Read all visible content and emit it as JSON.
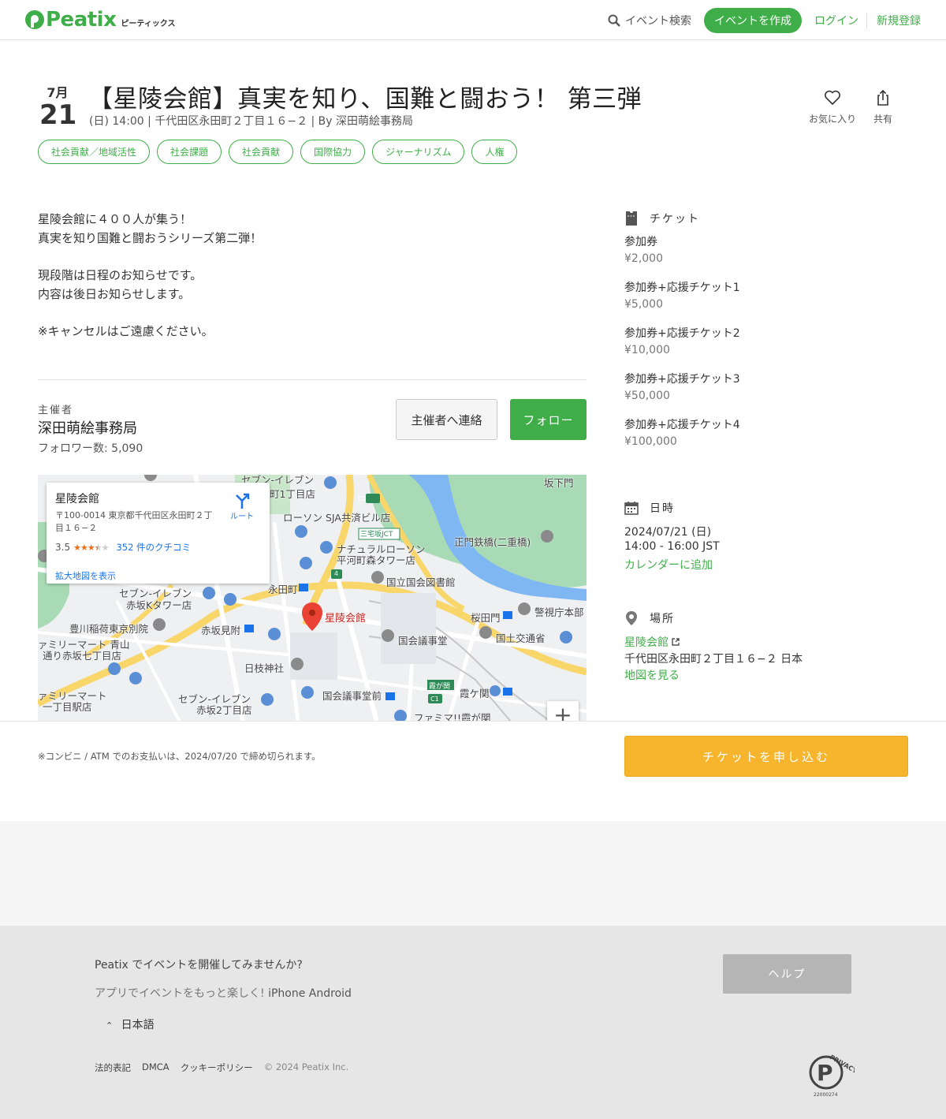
{
  "header": {
    "logo_text": "Peatix",
    "logo_sub": "ピーティックス",
    "search_label": "イベント検索",
    "create_label": "イベントを作成",
    "login_label": "ログイン",
    "signup_label": "新規登録",
    "brand_color": "#3fae49"
  },
  "event": {
    "month": "7月",
    "day": "21",
    "title": "【星陵会館】真実を知り、国難と闘おう！ 第三弾",
    "meta": "(日) 14:00 | 千代田区永田町２丁目１６−２ | By 深田萌絵事務局",
    "favorite_label": "お気に入り",
    "share_label": "共有",
    "tags": [
      "社会貢献／地域活性",
      "社会課題",
      "社会貢献",
      "国際協力",
      "ジャーナリズム",
      "人権"
    ]
  },
  "description": {
    "lines": [
      "星陵会館に４００人が集う！",
      "真実を知り国難と闘おうシリーズ第二弾！",
      "現段階は日程のお知らせです。",
      "内容は後日お知らせします。",
      "※キャンセルはご遠慮ください。"
    ]
  },
  "organizer": {
    "label": "主催者",
    "name": "深田萌絵事務局",
    "followers": "フォロワー数: 5,090",
    "contact_label": "主催者へ連絡",
    "follow_label": "フォロー"
  },
  "map": {
    "card_name": "星陵会館",
    "card_address": "〒100-0014 東京都千代田区永田町２丁目１６−２",
    "rating": "3.5",
    "stars_filled": 3.5,
    "reviews": "352 件のクチコミ",
    "enlarge": "拡大地図を表示",
    "route": "ルート",
    "zoom_in": "+",
    "labels": {
      "seven_eleven_top": "セブン-イレブン",
      "machi1": "町1丁目店",
      "lawson": "ローソン SJA共済ビル店",
      "sakashita": "坂下門",
      "miyake_jct": "三宅坂JCT",
      "natural_lawson": "ナチュラルローソン",
      "hirakawa": "平河町森タワー店",
      "seimon": "正門鉄橋(二重橋)",
      "nagatacho": "永田町",
      "kokkai_toshokan": "国立国会図書館",
      "seven_akasaka": "セブン-イレブン",
      "akasaka_k": "赤坂Kタワー店",
      "sakuradamon": "桜田門",
      "keishicho": "警視庁本部",
      "seiryo": "星陵会館",
      "toyokawa": "豊川稲荷東京別院",
      "akasaka_mitsuke": "赤坂見附",
      "kokkai_gijido": "国会議事堂",
      "kokudo": "国土交通省",
      "family_aoyama": "ァミリーマート 青山",
      "akasaka7": "通り赤坂七丁目店",
      "hie": "日枝神社",
      "kasumigaseki_tag": "霞が関",
      "kasumigaseki": "霞ケ関",
      "family_itchome": "ァミリーマート",
      "itchome_eki": "一丁目駅店",
      "seven_akasaka2": "セブン-イレブン",
      "akasaka2": "赤坂2丁目店",
      "gijido_mae": "国会議事堂前",
      "famima": "ファミマ!!霞が関",
      "c1": "C1",
      "r4": "4"
    }
  },
  "sidebar": {
    "ticket_heading": "チケット",
    "tickets": [
      {
        "name": "参加券",
        "price": "¥2,000"
      },
      {
        "name": "参加券+応援チケット1",
        "price": "¥5,000"
      },
      {
        "name": "参加券+応援チケット2",
        "price": "¥10,000"
      },
      {
        "name": "参加券+応援チケット3",
        "price": "¥50,000"
      },
      {
        "name": "参加券+応援チケット4",
        "price": "¥100,000"
      }
    ],
    "datetime_heading": "日時",
    "date": "2024/07/21 (日)",
    "time": "14:00 - 16:00 JST",
    "calendar_link": "カレンダーに追加",
    "place_heading": "場所",
    "venue_link": "星陵会館",
    "venue_address": "千代田区永田町２丁目１６−２ 日本",
    "map_link": "地図を見る"
  },
  "purchase": {
    "note": "※コンビニ / ATM でのお支払いは、2024/07/20 で締め切られます。",
    "apply_label": "チケットを申し込む",
    "apply_color": "#f6b52d"
  },
  "footer": {
    "host_prompt": "Peatix でイベントを開催してみませんか?",
    "app_prompt": "アプリでイベントをもっと楽しく!",
    "iphone": "iPhone",
    "android": "Android",
    "language": "日本語",
    "help_label": "ヘルプ",
    "links": [
      "法的表記",
      "DMCA",
      "クッキーポリシー"
    ],
    "copyright": "© 2024 Peatix Inc.",
    "privacy_mark_text": "PRIVACY",
    "privacy_mark_sub": "protecting your",
    "privacy_mark_number": "22000274"
  }
}
